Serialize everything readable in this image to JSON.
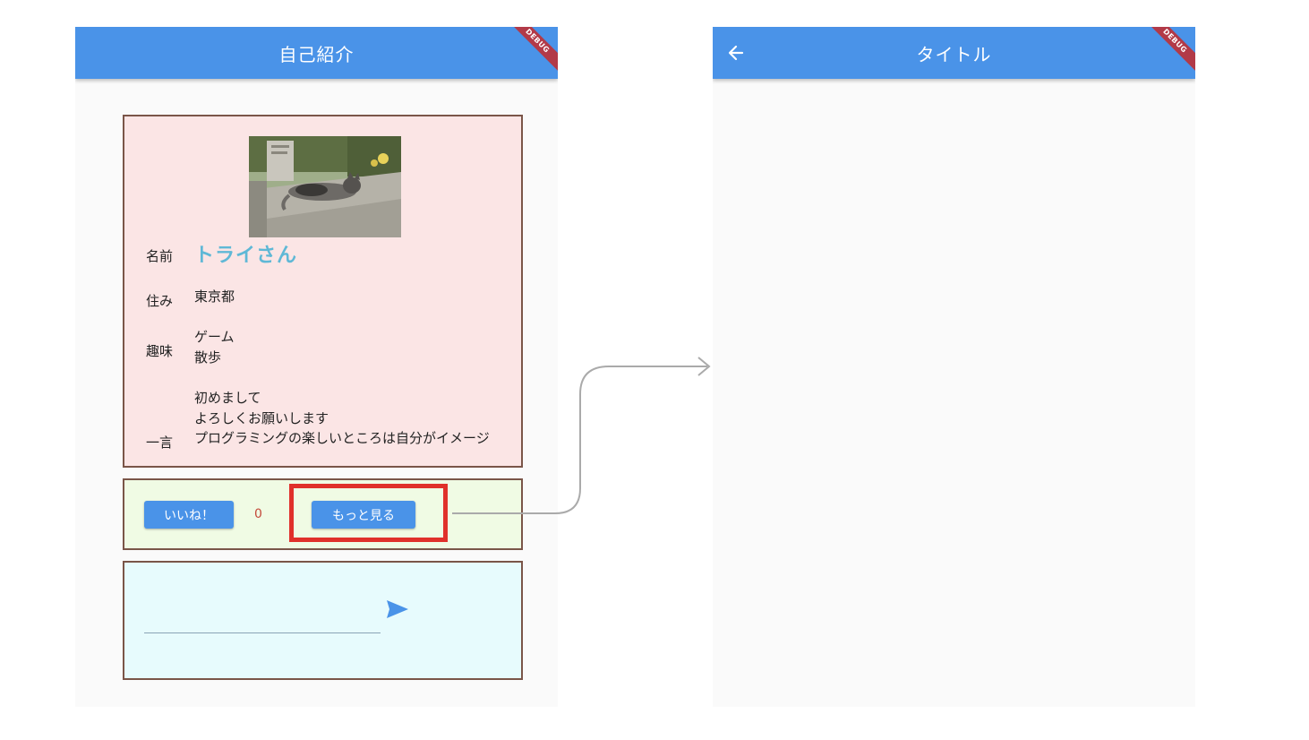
{
  "left_screen": {
    "appbar_title": "自己紹介",
    "debug_banner": "DEBUG",
    "profile": {
      "photo_icon": "cat-photo",
      "name_label": "名前",
      "name_value": "トライさん",
      "residence_label": "住み",
      "residence_value": "東京都",
      "hobby_label": "趣味",
      "hobbies": [
        "ゲーム",
        "散歩"
      ],
      "comment_label": "一言",
      "comment_lines": [
        "初めまして",
        "よろしくお願いします",
        "プログラミングの楽しいところは自分がイメージ"
      ]
    },
    "actions": {
      "like_label": "いいね！",
      "like_count": "0",
      "more_label": "もっと見る"
    },
    "input": {
      "value": "",
      "send_icon": "send-icon"
    }
  },
  "right_screen": {
    "appbar_title": "タイトル",
    "debug_banner": "DEBUG",
    "back_icon": "arrow-back-icon"
  },
  "colors": {
    "appbar": "#4a93e8",
    "profile_bg": "#fbe5e5",
    "action_bg": "#f0fbe4",
    "input_bg": "#e7fbfd",
    "card_border": "#7a5548",
    "name_color": "#5fb8d6",
    "highlight": "#e0302b"
  }
}
